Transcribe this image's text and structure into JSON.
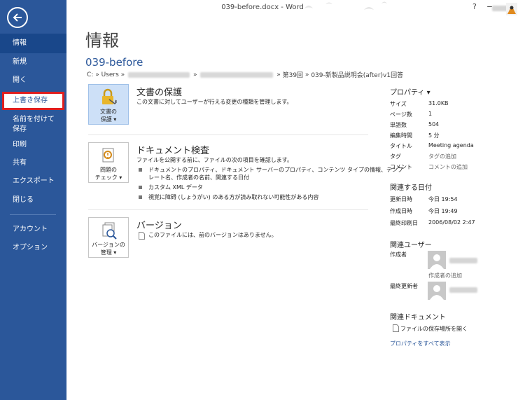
{
  "window": {
    "title": "039-before.docx - Word",
    "help_icon": "?",
    "minimize_icon": "−"
  },
  "sidebar": {
    "items": [
      {
        "label": "情報"
      },
      {
        "label": "新規"
      },
      {
        "label": "開く"
      },
      {
        "label": "上書き保存"
      },
      {
        "label": "名前を付けて保存"
      },
      {
        "label": "印刷"
      },
      {
        "label": "共有"
      },
      {
        "label": "エクスポート"
      },
      {
        "label": "閉じる"
      },
      {
        "label": "アカウント"
      },
      {
        "label": "オプション"
      }
    ]
  },
  "main": {
    "page_title": "情報",
    "doc_name": "039-before",
    "path": {
      "drive": "C:",
      "sep": "»",
      "users": "Users",
      "folder": "第39回",
      "file": "039-新製品説明会(after)v1回答"
    },
    "protect": {
      "tile_line1": "文書の",
      "tile_line2": "保護",
      "heading": "文書の保護",
      "desc": "この文書に対してユーザーが行える変更の種類を管理します。"
    },
    "inspect": {
      "tile_line1": "問題の",
      "tile_line2": "チェック",
      "heading": "ドキュメント検査",
      "desc": "ファイルを公開する前に、ファイルの次の項目を確認します。",
      "bullets": [
        "ドキュメントのプロパティ、ドキュメント サーバーのプロパティ、コンテンツ タイプの情報、テンプ",
        "レート名、作成者の名前、関連する日付",
        "カスタム XML データ",
        "視覚に障碍 (しょうがい) のある方が読み取れない可能性がある内容"
      ]
    },
    "version": {
      "tile_line1": "バージョンの",
      "tile_line2": "管理",
      "heading": "バージョン",
      "desc": "このファイルには、前のバージョンはありません。"
    }
  },
  "properties": {
    "header": "プロパティ",
    "rows": [
      {
        "key": "サイズ",
        "value": "31.0KB"
      },
      {
        "key": "ページ数",
        "value": "1"
      },
      {
        "key": "単語数",
        "value": "504"
      },
      {
        "key": "編集時間",
        "value": "5 分"
      },
      {
        "key": "タイトル",
        "value": "Meeting agenda"
      },
      {
        "key": "タグ",
        "value": "タグの追加"
      },
      {
        "key": "コメント",
        "value": "コメントの追加"
      }
    ],
    "dates_header": "関連する日付",
    "dates": [
      {
        "key": "更新日時",
        "value": "今日 19:54"
      },
      {
        "key": "作成日時",
        "value": "今日 19:49"
      },
      {
        "key": "最終印刷日",
        "value": "2006/08/02 2:47"
      }
    ],
    "users_header": "関連ユーザー",
    "author_label": "作成者",
    "add_author": "作成者の追加",
    "last_modified_label": "最終更新者",
    "docs_header": "関連ドキュメント",
    "open_location": "ファイルの保存場所を開く",
    "show_all": "プロパティをすべて表示"
  },
  "colors": {
    "sidebar": "#2b579a",
    "highlight_border": "#e01e1e",
    "link": "#2b579a"
  }
}
